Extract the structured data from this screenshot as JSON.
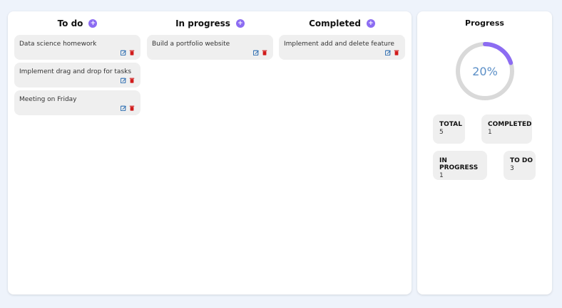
{
  "board": {
    "columns": [
      {
        "title": "To do",
        "add_icon": "plus-icon",
        "tasks": [
          {
            "text": "Data science homework"
          },
          {
            "text": "Implement drag and drop for tasks"
          },
          {
            "text": "Meeting on Friday"
          }
        ]
      },
      {
        "title": "In progress",
        "add_icon": "plus-icon",
        "tasks": [
          {
            "text": "Build a portfolio website"
          }
        ]
      },
      {
        "title": "Completed",
        "add_icon": "plus-icon",
        "tasks": [
          {
            "text": "Implement add and delete feature"
          }
        ]
      }
    ],
    "task_action_icons": [
      "edit-icon",
      "trash-icon"
    ]
  },
  "progress": {
    "title": "Progress",
    "percent_label": "20%",
    "percent_value": 0.2,
    "stats": {
      "total": {
        "label": "TOTAL",
        "value": "5"
      },
      "completed": {
        "label": "COMPLETED",
        "value": "1"
      },
      "in_progress": {
        "label": "IN PROGRESS",
        "value": "1"
      },
      "to_do": {
        "label": "TO DO",
        "value": "3"
      }
    }
  },
  "colors": {
    "accent": "#8c6cf2",
    "ring_track": "#d9d9d9",
    "edit_icon": "#2b6cb0",
    "trash_icon": "#d11a1a",
    "percent_text": "#5b8fc7"
  }
}
